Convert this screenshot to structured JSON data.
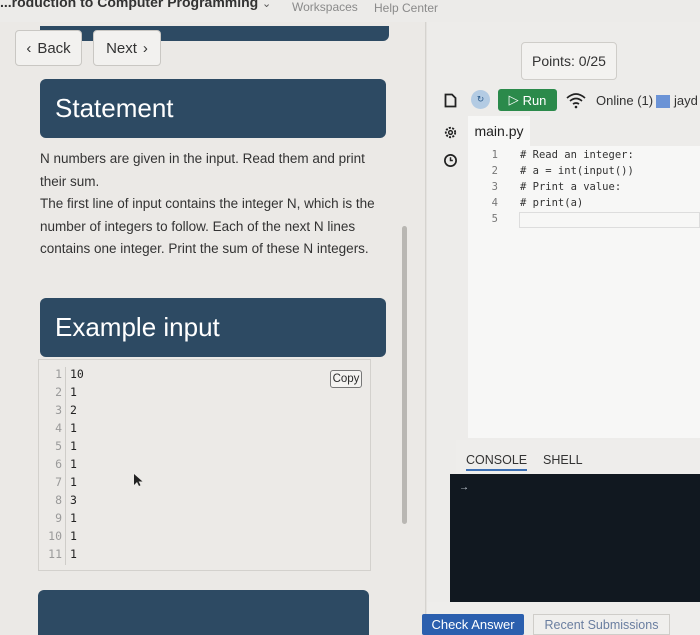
{
  "topnav": {
    "course_title": "...roduction to Computer Programming",
    "workspaces": "Workspaces",
    "help_center": "Help Center"
  },
  "nav": {
    "back": "Back",
    "next": "Next"
  },
  "statement": {
    "heading": "Statement",
    "paragraphs": [
      "N numbers are given in the input. Read them and print their sum.",
      "The first line of input contains the integer N, which is the number of integers to follow. Each of the next N lines contains one integer. Print the sum of these N integers."
    ]
  },
  "example": {
    "heading": "Example input",
    "copy_label": "Copy",
    "lines": [
      {
        "n": "1",
        "v": "10"
      },
      {
        "n": "2",
        "v": "1"
      },
      {
        "n": "3",
        "v": "2"
      },
      {
        "n": "4",
        "v": "1"
      },
      {
        "n": "5",
        "v": "1"
      },
      {
        "n": "6",
        "v": "1"
      },
      {
        "n": "7",
        "v": "1"
      },
      {
        "n": "8",
        "v": "3"
      },
      {
        "n": "9",
        "v": "1"
      },
      {
        "n": "10",
        "v": "1"
      },
      {
        "n": "11",
        "v": "1"
      }
    ]
  },
  "points": "Points: 0/25",
  "toolbar": {
    "run": "Run",
    "online": "Online (1)",
    "user": "jayd",
    "user_color": "#6b93d6"
  },
  "editor": {
    "tab": "main.py",
    "lines": [
      {
        "n": "1",
        "text": "# Read an integer:"
      },
      {
        "n": "2",
        "text": "# a = int(input())"
      },
      {
        "n": "3",
        "text": "# Print a value:"
      },
      {
        "n": "4",
        "text": "# print(a)"
      },
      {
        "n": "5",
        "text": ""
      }
    ]
  },
  "console": {
    "tab_console": "CONSOLE",
    "tab_shell": "SHELL",
    "prompt": "→"
  },
  "actions": {
    "check": "Check Answer",
    "recent": "Recent Submissions"
  },
  "colors": {
    "header_blue": "#2d4a63",
    "run_green": "#2b8a4b",
    "check_blue": "#2b5fae",
    "console_bg": "#111820"
  }
}
